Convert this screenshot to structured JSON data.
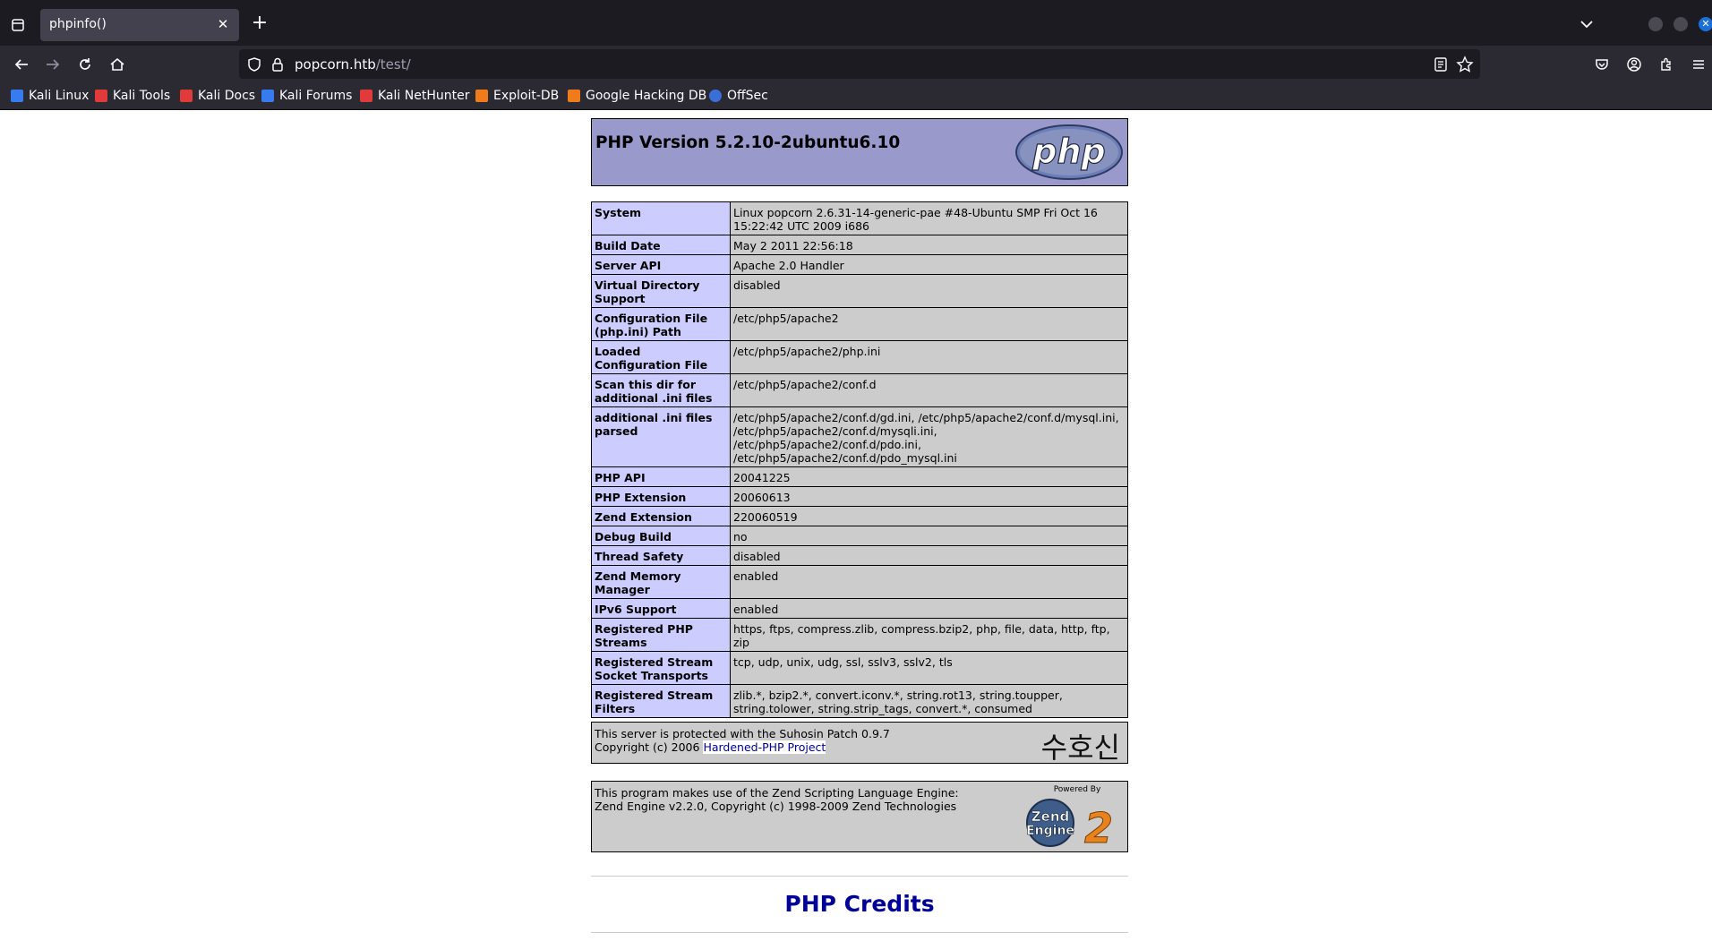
{
  "browser": {
    "tab_title": "phpinfo()",
    "url_host": "popcorn.htb",
    "url_path": "/test/"
  },
  "bookmarks": [
    {
      "label": "Kali Linux",
      "color": "#367bf0"
    },
    {
      "label": "Kali Tools",
      "color": "#e03a3a"
    },
    {
      "label": "Kali Docs",
      "color": "#e03a3a"
    },
    {
      "label": "Kali Forums",
      "color": "#367bf0"
    },
    {
      "label": "Kali NetHunter",
      "color": "#e03a3a"
    },
    {
      "label": "Exploit-DB",
      "color": "#f07b1a"
    },
    {
      "label": "Google Hacking DB",
      "color": "#f07b1a"
    },
    {
      "label": "OffSec",
      "color": "#3b6fd8"
    }
  ],
  "php": {
    "version_title": "PHP Version 5.2.10-2ubuntu6.10",
    "logo_text": "php",
    "info_rows": [
      {
        "key": "System",
        "value": "Linux popcorn 2.6.31-14-generic-pae #48-Ubuntu SMP Fri Oct 16 15:22:42 UTC 2009 i686"
      },
      {
        "key": "Build Date",
        "value": "May 2 2011 22:56:18"
      },
      {
        "key": "Server API",
        "value": "Apache 2.0 Handler"
      },
      {
        "key": "Virtual Directory Support",
        "value": "disabled"
      },
      {
        "key": "Configuration File (php.ini) Path",
        "value": "/etc/php5/apache2"
      },
      {
        "key": "Loaded Configuration File",
        "value": "/etc/php5/apache2/php.ini"
      },
      {
        "key": "Scan this dir for additional .ini files",
        "value": "/etc/php5/apache2/conf.d"
      },
      {
        "key": "additional .ini files parsed",
        "value": "/etc/php5/apache2/conf.d/gd.ini, /etc/php5/apache2/conf.d/mysql.ini, /etc/php5/apache2/conf.d/mysqli.ini, /etc/php5/apache2/conf.d/pdo.ini, /etc/php5/apache2/conf.d/pdo_mysql.ini"
      },
      {
        "key": "PHP API",
        "value": "20041225"
      },
      {
        "key": "PHP Extension",
        "value": "20060613"
      },
      {
        "key": "Zend Extension",
        "value": "220060519"
      },
      {
        "key": "Debug Build",
        "value": "no"
      },
      {
        "key": "Thread Safety",
        "value": "disabled"
      },
      {
        "key": "Zend Memory Manager",
        "value": "enabled"
      },
      {
        "key": "IPv6 Support",
        "value": "enabled"
      },
      {
        "key": "Registered PHP Streams",
        "value": "https, ftps, compress.zlib, compress.bzip2, php, file, data, http, ftp, zip"
      },
      {
        "key": "Registered Stream Socket Transports",
        "value": "tcp, udp, unix, udg, ssl, sslv3, sslv2, tls"
      },
      {
        "key": "Registered Stream Filters",
        "value": "zlib.*, bzip2.*, convert.iconv.*, string.rot13, string.toupper, string.tolower, string.strip_tags, convert.*, consumed"
      }
    ],
    "suhosin": {
      "line1": "This server is protected with the Suhosin Patch 0.9.7",
      "line2_prefix": "Copyright (c) 2006 ",
      "link": "Hardened-PHP Project",
      "logo_text": "수호신"
    },
    "zend": {
      "line1": "This program makes use of the Zend Scripting Language Engine:",
      "line2": "Zend Engine v2.2.0, Copyright (c) 1998-2009 Zend Technologies",
      "logo_powered": "Powered By",
      "logo_line1": "Zend",
      "logo_line2": "Engine",
      "logo_num": "2"
    },
    "credits": "PHP Credits"
  }
}
